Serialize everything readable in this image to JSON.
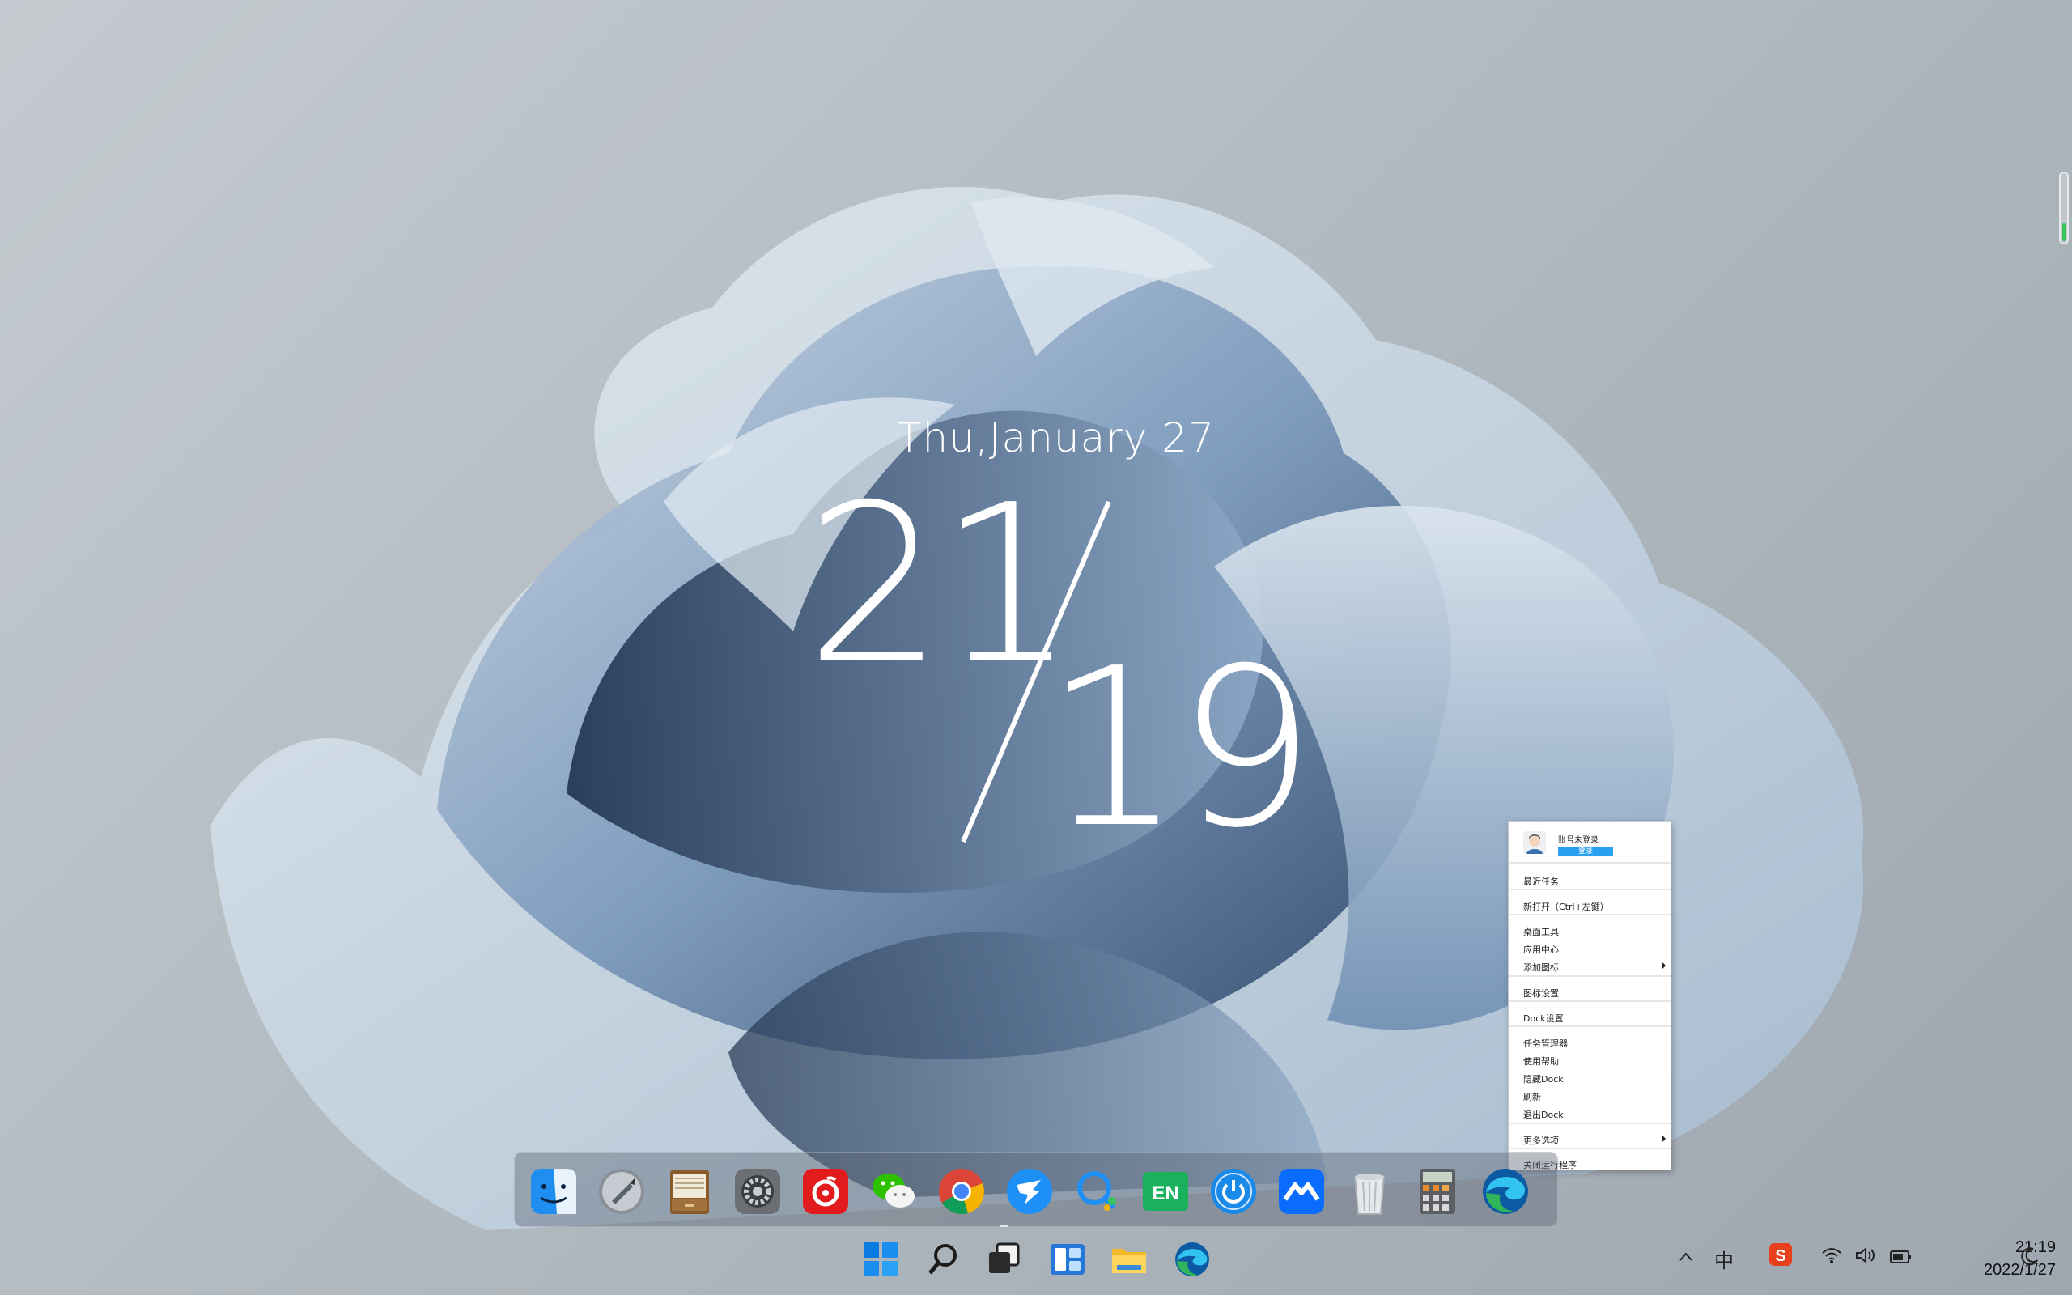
{
  "clock": {
    "date": "Thu,January 27",
    "hour": "21",
    "minute": "19"
  },
  "context_menu": {
    "account_name": "账号未登录",
    "login_label": "登录",
    "items": [
      "最近任务",
      "新打开（Ctrl+左键）",
      "桌面工具",
      "应用中心",
      "添加图标",
      "图标设置",
      "Dock设置",
      "任务管理器",
      "使用帮助",
      "隐藏Dock",
      "刷新",
      "退出Dock",
      "更多选项",
      "关闭运行程序"
    ]
  },
  "dock": {
    "icons": [
      "finder-icon",
      "launchpad-icon",
      "file-drawer-icon",
      "system-settings-icon",
      "netease-music-icon",
      "wechat-icon",
      "chrome-icon",
      "dingtalk-icon",
      "search-app-icon",
      "en-translator-icon",
      "power-icon",
      "tencent-meeting-icon",
      "trash-icon",
      "calculator-icon",
      "edge-icon"
    ]
  },
  "taskbar": {
    "icons": [
      "start-icon",
      "search-icon",
      "task-view-icon",
      "widgets-icon",
      "file-explorer-icon",
      "edge-icon"
    ],
    "input_method": "中",
    "time": "21:19",
    "date": "2022/1/27"
  },
  "colors": {
    "accent": "#2aa1f0",
    "battery_indicator": "#39c35d"
  }
}
